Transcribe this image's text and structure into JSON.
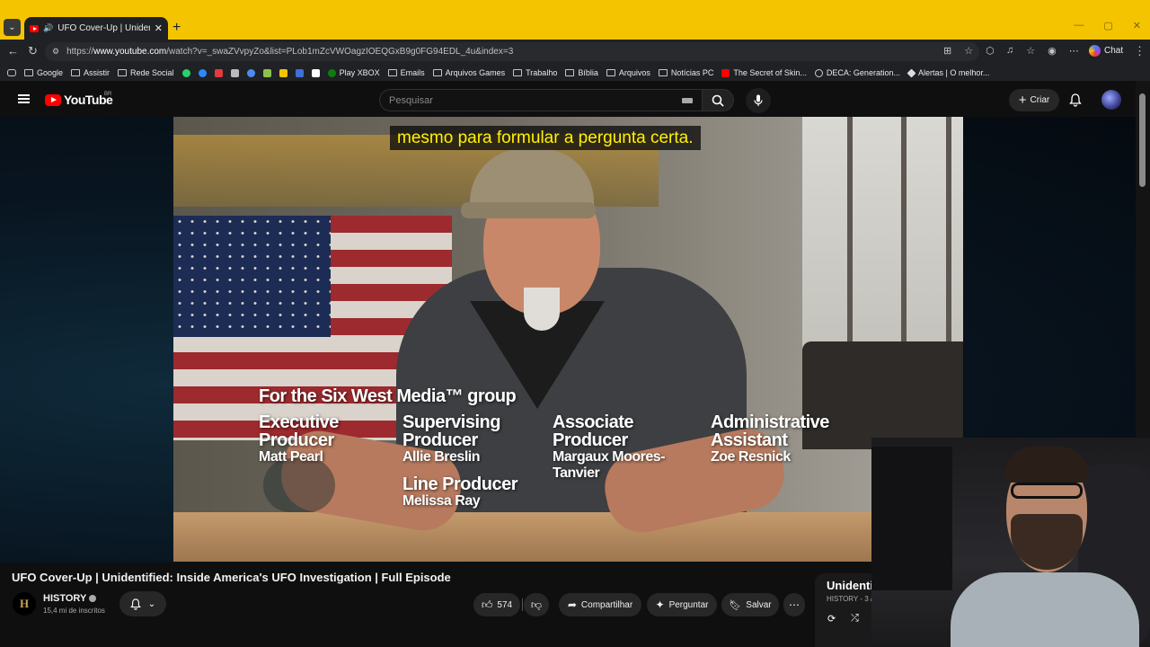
{
  "browser": {
    "tab_title": "UFO Cover-Up | Unidentified:",
    "new_tab_symbol": "+",
    "url_prefix": "https://",
    "url_domain": "www.youtube.com",
    "url_rest": "/watch?v=_swaZVvpyZo&list=PLob1mZcVWOagzIOEQGxB9g0FG94EDL_4u&index=3",
    "chat_label": "Chat",
    "bookmarks": [
      {
        "label": "Google",
        "icon": "folder-icon"
      },
      {
        "label": "Assistir",
        "icon": "folder-icon"
      },
      {
        "label": "Rede Social",
        "icon": "folder-icon"
      },
      {
        "label": "Play XBOX",
        "icon": "xbox-icon"
      },
      {
        "label": "Emails",
        "icon": "folder-icon"
      },
      {
        "label": "Arquivos Games",
        "icon": "folder-icon"
      },
      {
        "label": "Trabalho",
        "icon": "folder-icon"
      },
      {
        "label": "Bíblia",
        "icon": "folder-icon"
      },
      {
        "label": "Arquivos",
        "icon": "folder-icon"
      },
      {
        "label": "Notícias PC",
        "icon": "folder-icon"
      },
      {
        "label": "The Secret of Skin...",
        "icon": "youtube-icon"
      },
      {
        "label": "DECA: Generation...",
        "icon": "globe-icon"
      },
      {
        "label": "Alertas | O melhor...",
        "icon": "alert-icon"
      }
    ]
  },
  "youtube": {
    "logo_text": "YouTube",
    "region": "BR",
    "search_placeholder": "Pesquisar",
    "create_label": "Criar",
    "subtitle": "mesmo para formular a pergunta certa.",
    "credits": {
      "heading": "For the Six West Media™ group",
      "executive_role_1": "Executive",
      "executive_role_2": "Producer",
      "executive_name": "Matt Pearl",
      "supervising_role_1": "Supervising",
      "supervising_role_2": "Producer",
      "supervising_name": "Allie Breslin",
      "associate_role_1": "Associate",
      "associate_role_2": "Producer",
      "associate_name_1": "Margaux Moores-",
      "associate_name_2": "Tanvier",
      "admin_role_1": "Administrative",
      "admin_role_2": "Assistant",
      "admin_name": "Zoe Resnick",
      "line_role": "Line Producer",
      "line_name": "Melissa Ray"
    },
    "video_title": "UFO Cover-Up | Unidentified: Inside America's UFO Investigation | Full Episode",
    "channel": {
      "avatar_letter": "H",
      "name": "HISTORY",
      "subscribers": "15,4 mi de inscritos"
    },
    "actions": {
      "like_count": "574",
      "share_label": "Compartilhar",
      "ask_label": "Perguntar",
      "save_label": "Salvar"
    },
    "playlist": {
      "title": "Unidenti",
      "meta": "HISTORY - 3 /"
    }
  },
  "colors": {
    "tabstrip": "#f5c400",
    "subtitle_text": "#fff200",
    "youtube_red": "#ff0000"
  }
}
